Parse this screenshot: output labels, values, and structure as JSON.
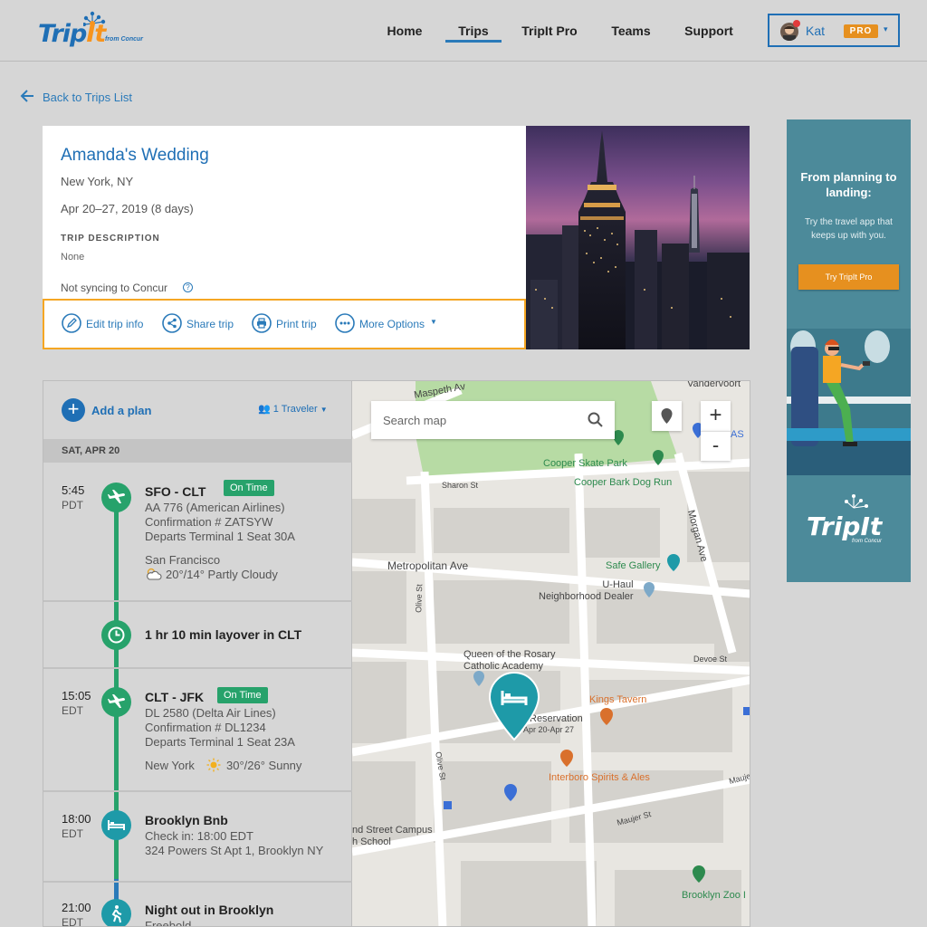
{
  "header": {
    "logo_text_a": "Trip",
    "logo_text_b": "It",
    "logo_sub": "from Concur",
    "nav": [
      "Home",
      "Trips",
      "TripIt Pro",
      "Teams",
      "Support"
    ],
    "active_nav": "Trips",
    "user": {
      "name": "Kat",
      "badge": "PRO",
      "caret": "▾"
    }
  },
  "back_link": "Back to Trips List",
  "trip": {
    "title": "Amanda's Wedding",
    "location": "New York, NY",
    "dates": "Apr 20–27, 2019 (8 days)",
    "description_label": "TRIP DESCRIPTION",
    "description": "None",
    "concur_status": "Not syncing to Concur",
    "help": "?",
    "actions": {
      "edit": "Edit trip info",
      "share": "Share trip",
      "print": "Print trip",
      "more": "More Options"
    }
  },
  "ad": {
    "headline": "From planning to landing:",
    "sub": "Try the travel app that keeps up with you.",
    "button": "Try TripIt Pro",
    "logo_a": "TripIt",
    "logo_sub": "from Concur"
  },
  "itinerary": {
    "add_plan": "Add a plan",
    "plus": "+",
    "travelers": "1 Traveler",
    "day": "SAT, APR 20",
    "items": [
      {
        "time": "5:45",
        "tz": "PDT",
        "title": "SFO - CLT",
        "status": "On Time",
        "lines": [
          "AA 776 (American Airlines)",
          "Confirmation # ZATSYW",
          "Departs Terminal 1 Seat 30A"
        ],
        "city": "San Francisco",
        "weather": "20°/14° Partly Cloudy"
      },
      {
        "title": "1 hr 10 min layover in CLT"
      },
      {
        "time": "15:05",
        "tz": "EDT",
        "title": "CLT - JFK",
        "status": "On Time",
        "lines": [
          "DL 2580 (Delta Air Lines)",
          "Confirmation # DL1234",
          "Departs Terminal 1 Seat 23A"
        ],
        "city": "New York",
        "weather": "30°/26° Sunny"
      },
      {
        "time": "18:00",
        "tz": "EDT",
        "title": "Brooklyn Bnb",
        "lines": [
          "Check in: 18:00 EDT",
          "324 Powers St Apt 1, Brooklyn NY"
        ]
      },
      {
        "time": "21:00",
        "tz": "EDT",
        "title": "Night out in Brooklyn",
        "lines": [
          "Freebold"
        ]
      }
    ]
  },
  "map": {
    "search_placeholder": "Search map",
    "zoom_in": "+",
    "zoom_out": "-",
    "labels": {
      "maspeth": "Maspeth Av",
      "vandervoort": "Vandervoort",
      "skate": "Cooper Skate Park",
      "dogrun": "Cooper Bark Dog Run",
      "sharon": "Sharon St",
      "morgan": "Morgan Ave",
      "metropolitan": "Metropolitan Ave",
      "safe": "Safe Gallery",
      "uhaul": "U-Haul\nNeighborhood Dealer",
      "olive": "Olive St",
      "queen": "Queen of the Rosary\nCatholic Academy",
      "devoe": "Devoe St",
      "kings": "Kings Tavern",
      "reservation": "Reservation",
      "reservation_dates": "Apr 20-Apr 27",
      "olive2": "Olive St",
      "interboro": "Interboro Spirits & Ales",
      "maujer": "Maujer St",
      "maujer2": "Mauje",
      "campus": "nd Street Campus\nh School",
      "zoo": "Brooklyn Zoo I",
      "as": "AS"
    }
  },
  "colors": {
    "brand": "#1f6fb5",
    "orange": "#f5a623",
    "green": "#27a26b",
    "teal": "#1e9aa8"
  }
}
